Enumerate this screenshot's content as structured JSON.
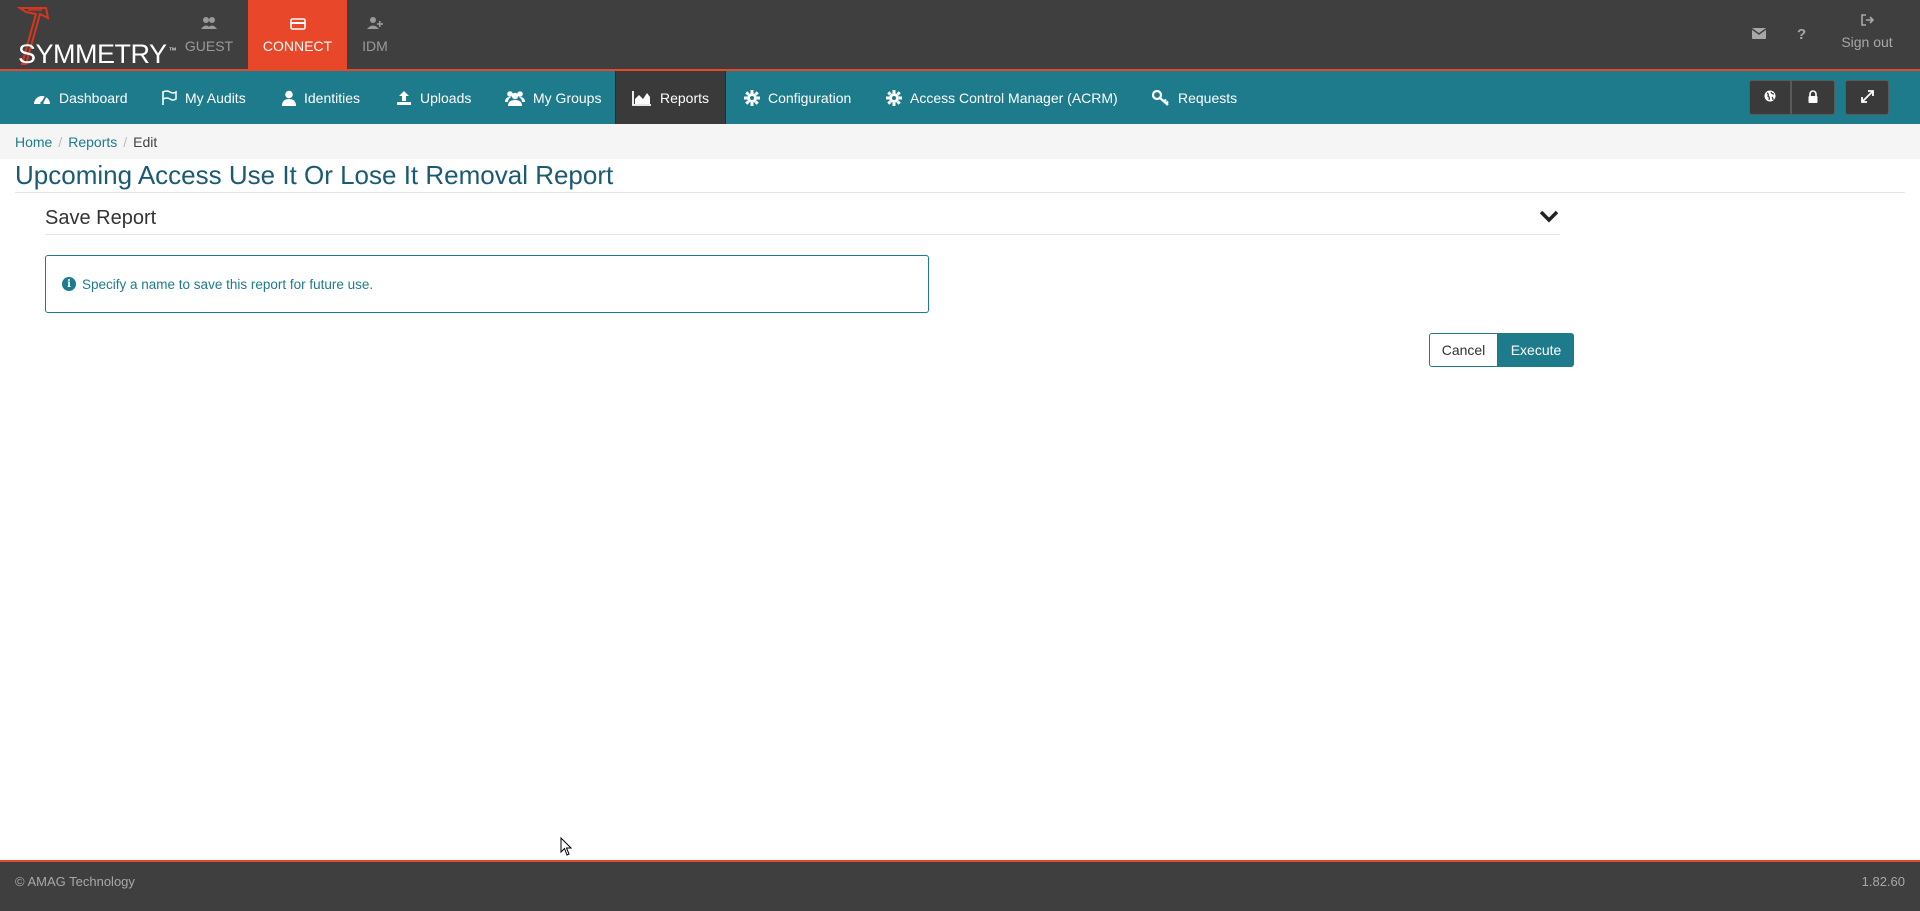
{
  "header": {
    "logo_text": "SYMMETRY",
    "logo_tm": "™",
    "app_tabs": [
      {
        "label": "GUEST",
        "icon": "users-icon",
        "active": false
      },
      {
        "label": "CONNECT",
        "icon": "card-icon",
        "active": true
      },
      {
        "label": "IDM",
        "icon": "user-add-icon",
        "active": false
      }
    ],
    "sign_out": "Sign out"
  },
  "nav": {
    "items": [
      {
        "label": "Dashboard",
        "icon": "dashboard-icon"
      },
      {
        "label": "My Audits",
        "icon": "flag-icon"
      },
      {
        "label": "Identities",
        "icon": "user-icon"
      },
      {
        "label": "Uploads",
        "icon": "upload-icon"
      },
      {
        "label": "My Groups",
        "icon": "users-icon"
      },
      {
        "label": "Reports",
        "icon": "area-chart-icon",
        "active": true
      },
      {
        "label": "Configuration",
        "icon": "gear-icon"
      },
      {
        "label": "Access Control Manager (ACRM)",
        "icon": "gear-icon"
      },
      {
        "label": "Requests",
        "icon": "key-icon"
      }
    ]
  },
  "breadcrumb": {
    "home": "Home",
    "reports": "Reports",
    "current": "Edit",
    "separator": "/"
  },
  "page": {
    "title": "Upcoming Access Use It Or Lose It Removal Report",
    "section_title": "Save Report",
    "info_message": "Specify a name to save this report for future use.",
    "cancel_label": "Cancel",
    "execute_label": "Execute"
  },
  "footer": {
    "copyright": "© AMAG Technology",
    "version": "1.82.60"
  },
  "colors": {
    "header_bg": "#3f3f3f",
    "accent_red": "#e8472a",
    "nav_teal": "#1d7b8c",
    "title_blue": "#1a5a73"
  }
}
